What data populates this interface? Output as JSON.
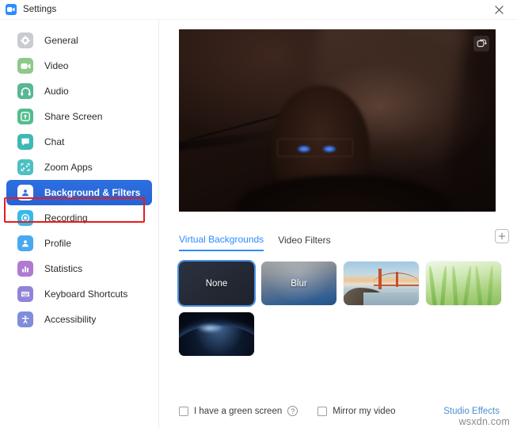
{
  "window": {
    "title": "Settings",
    "app_icon": "zoom-logo-icon",
    "close_label": "×"
  },
  "sidebar": {
    "items": [
      {
        "label": "General",
        "icon": "gear-icon",
        "color": "#c8cbcf",
        "active": false
      },
      {
        "label": "Video",
        "icon": "video-camera-icon",
        "color": "#8ec98a",
        "active": false
      },
      {
        "label": "Audio",
        "icon": "headphones-icon",
        "color": "#57b894",
        "active": false
      },
      {
        "label": "Share Screen",
        "icon": "share-screen-icon",
        "color": "#52bd8e",
        "active": false
      },
      {
        "label": "Chat",
        "icon": "chat-bubble-icon",
        "color": "#3fb8b4",
        "active": false
      },
      {
        "label": "Zoom Apps",
        "icon": "zoom-apps-icon",
        "color": "#4dc0c4",
        "active": false
      },
      {
        "label": "Background & Filters",
        "icon": "background-person-icon",
        "color": "#2d6fe0",
        "active": true
      },
      {
        "label": "Recording",
        "icon": "recording-icon",
        "color": "#36b9e8",
        "active": false
      },
      {
        "label": "Profile",
        "icon": "profile-person-icon",
        "color": "#4aa8f0",
        "active": false
      },
      {
        "label": "Statistics",
        "icon": "statistics-bars-icon",
        "color": "#b07ad1",
        "active": false
      },
      {
        "label": "Keyboard Shortcuts",
        "icon": "keyboard-icon",
        "color": "#9184d8",
        "active": false
      },
      {
        "label": "Accessibility",
        "icon": "accessibility-icon",
        "color": "#7f8ddb",
        "active": false
      }
    ],
    "highlight": {
      "color": "#e81b1b",
      "target": "Background & Filters"
    }
  },
  "preview": {
    "name": "video-preview",
    "flip_camera_icon": "camera-flip-icon"
  },
  "tabs": [
    {
      "label": "Virtual Backgrounds",
      "active": true
    },
    {
      "label": "Video Filters",
      "active": false
    }
  ],
  "add_button": {
    "icon": "plus-icon",
    "label": "+"
  },
  "backgrounds": [
    {
      "label": "None",
      "selected": true,
      "style": "none"
    },
    {
      "label": "Blur",
      "selected": false,
      "style": "blur"
    },
    {
      "label": "",
      "selected": false,
      "style": "bridge"
    },
    {
      "label": "",
      "selected": false,
      "style": "grass"
    },
    {
      "label": "",
      "selected": false,
      "style": "earth"
    }
  ],
  "footer": {
    "green_screen_label": "I have a green screen",
    "green_screen_checked": false,
    "help_icon": "question-mark-icon",
    "help_glyph": "?",
    "mirror_label": "Mirror my video",
    "mirror_checked": false,
    "studio_effects_label": "Studio Effects"
  },
  "watermark": "wsxdn.com",
  "colors": {
    "accent": "#2d8cff",
    "active_nav": "#2d6fe0",
    "annotation": "#e81b1b",
    "link": "#4a8fd4"
  }
}
